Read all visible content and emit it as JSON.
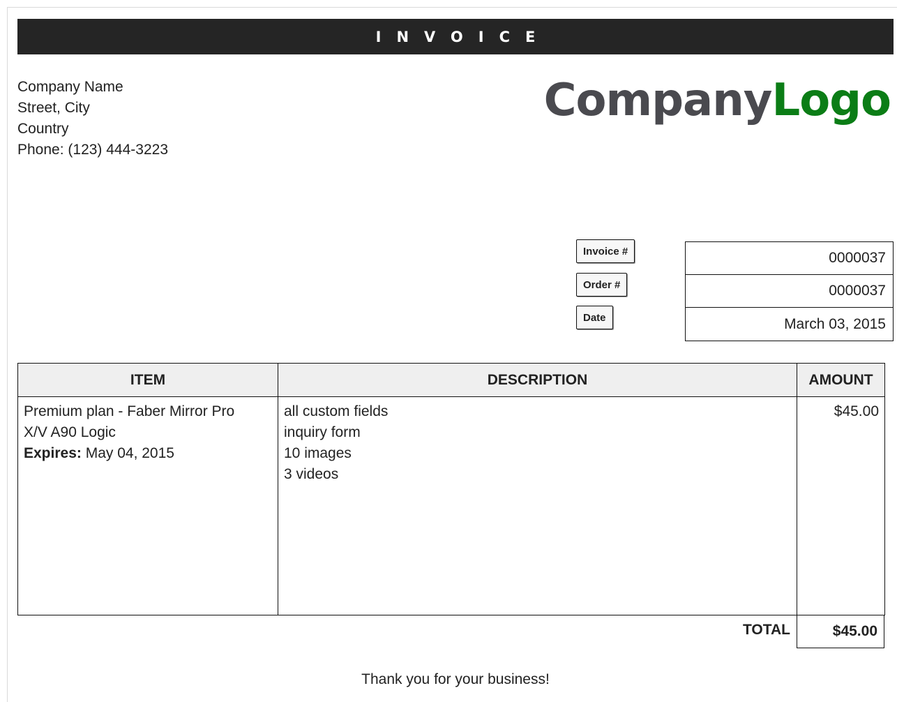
{
  "header": {
    "title": "INVOICE"
  },
  "company": {
    "name": "Company Name",
    "street": "Street, City",
    "country": "Country",
    "phone": "Phone: (123) 444-3223"
  },
  "logo": {
    "part1": "Company",
    "part2": "Logo",
    "colors": {
      "part1": "#4a4a4f",
      "part2": "#0b7d16"
    }
  },
  "meta": {
    "invoice_label": "Invoice #",
    "order_label": "Order #",
    "date_label": "Date",
    "invoice_number": "0000037",
    "order_number": "0000037",
    "date": "March 03, 2015"
  },
  "table": {
    "headers": {
      "item": "ITEM",
      "description": "DESCRIPTION",
      "amount": "AMOUNT"
    },
    "rows": [
      {
        "item_line1": "Premium plan - Faber Mirror Pro",
        "item_line2": "X/V A90 Logic",
        "expires_label": "Expires:",
        "expires_value": "May 04, 2015",
        "description": [
          "all custom fields",
          "inquiry form",
          "10 images",
          "3 videos"
        ],
        "amount": "$45.00"
      }
    ]
  },
  "total": {
    "label": "TOTAL",
    "value": "$45.00"
  },
  "footer": {
    "thanks": "Thank you for your business!"
  }
}
